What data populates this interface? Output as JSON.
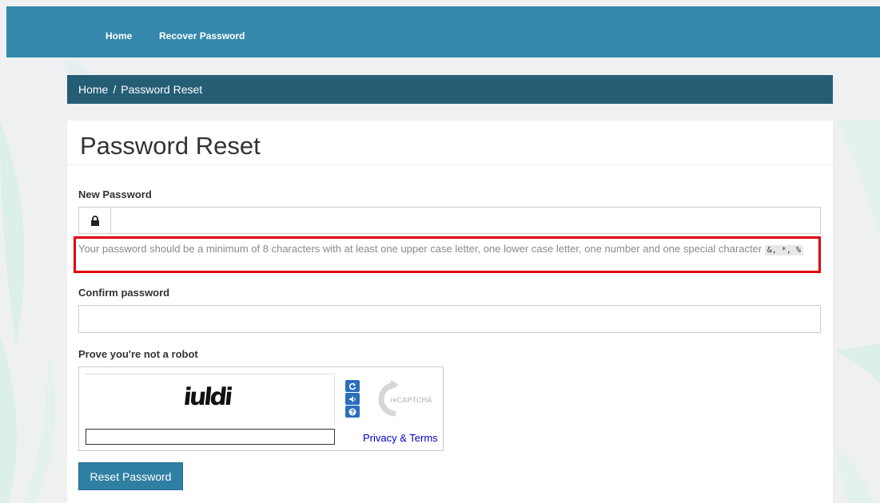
{
  "nav": {
    "home": "Home",
    "recover": "Recover Password"
  },
  "breadcrumb": {
    "home": "Home",
    "separator": "/",
    "current": "Password Reset"
  },
  "page": {
    "title": "Password Reset"
  },
  "form": {
    "new_password_label": "New Password",
    "new_password_value": "",
    "help_text": "Your password should be a minimum of 8 characters with at least one upper case letter, one lower case letter, one number and one special character",
    "special_chars": "&, *, %",
    "confirm_label": "Confirm password",
    "confirm_value": "",
    "robot_label": "Prove you're not a robot",
    "captcha_challenge": "iuldi",
    "captcha_answer": "",
    "privacy_terms": "Privacy & Terms",
    "recaptcha_brand": "reCAPTCHA",
    "submit_label": "Reset Password"
  },
  "colors": {
    "topbar": "#3489ad",
    "breadcrumb": "#255d75",
    "highlight_border": "#e0000a",
    "button": "#2f7fa3",
    "link": "#0000cc"
  },
  "icons": {
    "lock": "lock-icon",
    "refresh": "refresh-icon",
    "audio": "audio-icon",
    "help": "help-icon"
  }
}
